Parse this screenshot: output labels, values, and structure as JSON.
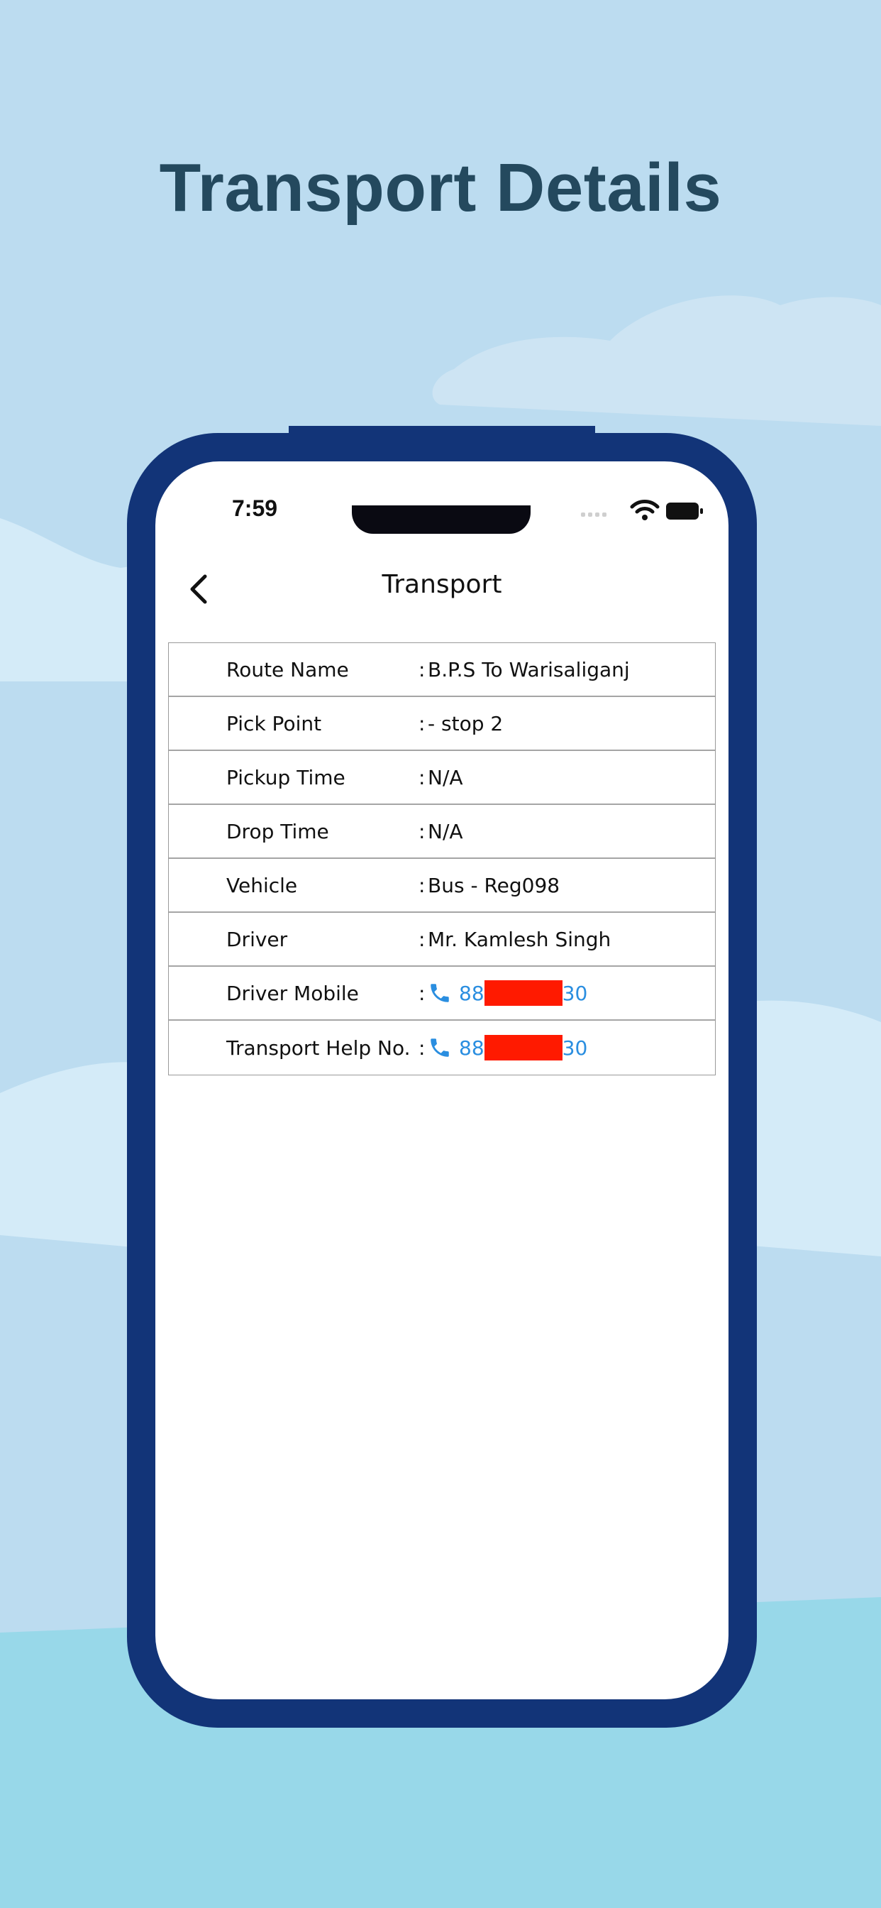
{
  "headline": "Transport Details",
  "status_bar": {
    "time": "7:59",
    "icons": [
      "signal-icon",
      "wifi-icon",
      "battery-icon"
    ]
  },
  "nav": {
    "title": "Transport",
    "back_icon": "chevron-left-icon"
  },
  "details": [
    {
      "label": "Route Name",
      "colon": ":",
      "value": "B.P.S To Warisaliganj"
    },
    {
      "label": "Pick Point",
      "colon": ":",
      "value": " - stop 2"
    },
    {
      "label": "Pickup Time",
      "colon": ":",
      "value": "N/A"
    },
    {
      "label": "Drop Time",
      "colon": ":",
      "value": "N/A"
    },
    {
      "label": "Vehicle",
      "colon": ":",
      "value": "Bus - Reg098"
    },
    {
      "label": "Driver",
      "colon": ":",
      "value": "Mr. Kamlesh Singh"
    },
    {
      "label": "Driver Mobile",
      "colon": ":",
      "prefix": "88",
      "suffix": "30"
    },
    {
      "label": "Transport Help No.",
      "colon": ":",
      "prefix": "88",
      "suffix": "30"
    }
  ],
  "colors": {
    "background": "#bcdcf0",
    "headline": "#24495e",
    "phone_frame": "#123478",
    "link": "#2a8ee0",
    "redaction": "#ff1a00"
  }
}
